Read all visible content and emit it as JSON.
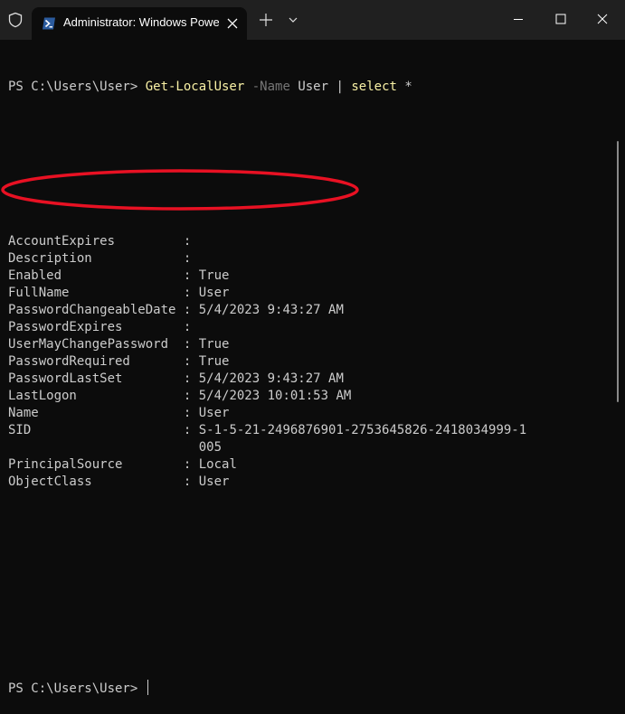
{
  "titlebar": {
    "tab_title": "Administrator: Windows PowerShell",
    "icons": [
      "shield-icon",
      "powershell-icon",
      "close-icon",
      "plus-icon",
      "chevron-down-icon",
      "minimize-icon",
      "maximize-icon",
      "close-icon"
    ]
  },
  "terminal": {
    "prompt": "PS C:\\Users\\User> ",
    "command": {
      "cmdlet": "Get-LocalUser",
      "param": "-Name",
      "param_value": "User",
      "pipe": "|",
      "select": "select",
      "star": "*"
    },
    "properties": [
      {
        "name": "AccountExpires",
        "value": ""
      },
      {
        "name": "Description",
        "value": ""
      },
      {
        "name": "Enabled",
        "value": "True"
      },
      {
        "name": "FullName",
        "value": "User"
      },
      {
        "name": "PasswordChangeableDate",
        "value": "5/4/2023 9:43:27 AM"
      },
      {
        "name": "PasswordExpires",
        "value": ""
      },
      {
        "name": "UserMayChangePassword",
        "value": "True"
      },
      {
        "name": "PasswordRequired",
        "value": "True"
      },
      {
        "name": "PasswordLastSet",
        "value": "5/4/2023 9:43:27 AM"
      },
      {
        "name": "LastLogon",
        "value": "5/4/2023 10:01:53 AM"
      },
      {
        "name": "Name",
        "value": "User"
      },
      {
        "name": "SID",
        "value": "S-1-5-21-2496876901-2753645826-2418034999-1"
      },
      {
        "name": "",
        "value": "005"
      },
      {
        "name": "PrincipalSource",
        "value": "Local"
      },
      {
        "name": "ObjectClass",
        "value": "User"
      }
    ],
    "separator": ": ",
    "final_prompt": "PS C:\\Users\\User> "
  },
  "colors": {
    "background": "#0c0c0c",
    "titlebar": "#202020",
    "text": "#cccccc",
    "cmdlet": "#f9f1a5",
    "parameter": "#767676",
    "annotation": "#e81123"
  }
}
